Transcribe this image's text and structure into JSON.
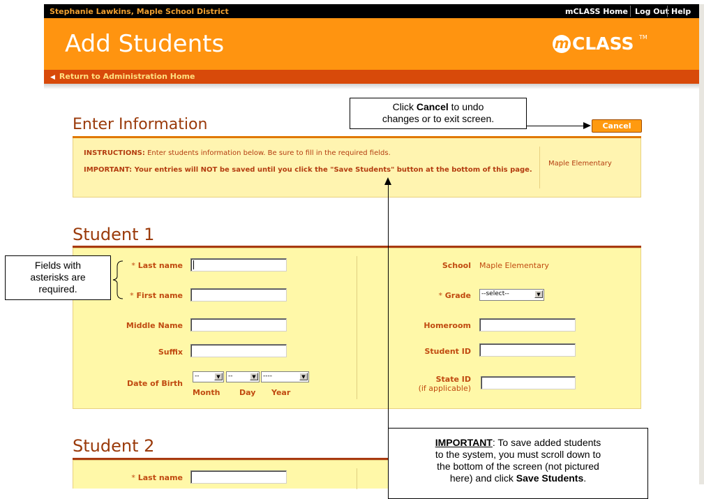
{
  "topbar": {
    "user": "Stephanie Lawkins, Maple School District",
    "links": [
      "mCLASS Home",
      "Log Out",
      "Help"
    ]
  },
  "header": {
    "title": "Add Students",
    "logo_mark": "m",
    "logo_text": "CLASS",
    "logo_tm": "TM"
  },
  "return_link": "Return to Administration Home",
  "enter_info": {
    "heading": "Enter Information",
    "cancel_label": "Cancel",
    "instructions_label": "INSTRUCTIONS:",
    "instructions_text": "Enter students information below. Be sure to fill in the required fields.",
    "important_text": "IMPORTANT: Your entries will NOT be saved until you click the \"Save Students\" button at the bottom of this page.",
    "school": "Maple Elementary"
  },
  "student1": {
    "heading": "Student 1",
    "last_name_label": "Last name",
    "first_name_label": "First name",
    "middle_name_label": "Middle Name",
    "suffix_label": "Suffix",
    "dob_label": "Date of Birth",
    "month_value": "--",
    "day_value": "--",
    "year_value": "----",
    "month_label": "Month",
    "day_label": "Day",
    "year_label": "Year",
    "school_label": "School",
    "school_value": "Maple Elementary",
    "grade_label": "Grade",
    "grade_value": "--select--",
    "homeroom_label": "Homeroom",
    "student_id_label": "Student ID",
    "state_id_label": "State ID",
    "state_id_sub": "(if applicable)"
  },
  "student2": {
    "heading": "Student 2",
    "last_name_label": "Last name"
  },
  "asterisk": "*",
  "callouts": {
    "cancel_pre": "Click ",
    "cancel_bold": "Cancel",
    "cancel_post": " to undo",
    "cancel_line2": "changes or to exit screen.",
    "fields_line1": "Fields with",
    "fields_line2": "asterisks are",
    "fields_line3": "required.",
    "important_bold": "IMPORTANT",
    "important_rest": ": To save added students",
    "important_line2": "to the system, you must scroll down to",
    "important_line3": "the bottom of the screen (not pictured",
    "important_line4_pre": "here) and click ",
    "important_line4_bold": "Save Students",
    "important_line4_post": "."
  }
}
